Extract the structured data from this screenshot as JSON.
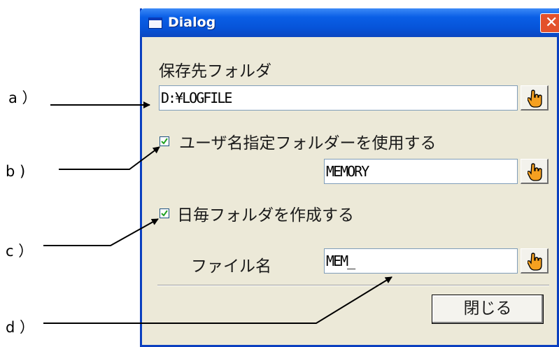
{
  "window": {
    "title": "Dialog"
  },
  "folder": {
    "label": "保存先フォルダ",
    "path_value": "D:¥LOGFILE"
  },
  "user_folder": {
    "checkbox_label": "ユーザ名指定フォルダーを使用する",
    "checked": true,
    "value": "MEMORY"
  },
  "daily_folder": {
    "checkbox_label": "日毎フォルダを作成する",
    "checked": true
  },
  "file_name": {
    "label": "ファイル名",
    "value": "MEM_"
  },
  "buttons": {
    "close_label": "閉じる"
  },
  "callouts": {
    "a": "a ）",
    "b": "b )",
    "c": "c ）",
    "d": "d ）"
  },
  "icons": {
    "browse": "hand-pointer-icon",
    "close": "close-icon",
    "window": "window-icon"
  },
  "colors": {
    "titlebar": "#0653d8",
    "dialog_bg": "#ece9d8",
    "close_button": "#e3512c"
  }
}
